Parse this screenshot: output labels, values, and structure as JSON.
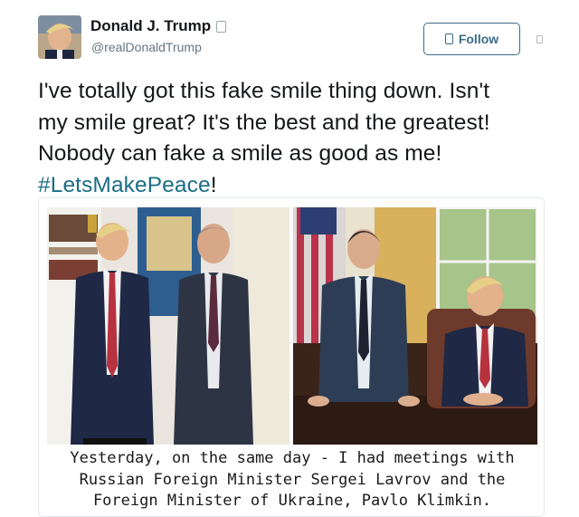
{
  "tweet": {
    "author": {
      "display_name": "Donald J. Trump",
      "handle": "@realDonaldTrump",
      "avatar": "avatar-photo",
      "verified_icon": "verified-badge-icon"
    },
    "follow_button": {
      "label": "Follow",
      "icon": "follow-user-icon"
    },
    "more_icon": "caret-menu-icon",
    "text_lines": [
      "I've totally got this fake smile thing down. Isn't",
      "my smile great? It's the best and the greatest!",
      "Nobody can fake a smile as good as me!"
    ],
    "hashtag": "#LetsMakePeace",
    "text_end": "!",
    "media": {
      "caption_lines": [
        "Yesterday, on the same day - I had meetings with",
        "Russian Foreign Minister Sergei Lavrov and the",
        "Foreign Minister of Ukraine, Pavlo Klimkin."
      ]
    }
  },
  "colors": {
    "link": "#1b6d86",
    "follow_border": "#3b6b8a",
    "handle": "#657786"
  }
}
